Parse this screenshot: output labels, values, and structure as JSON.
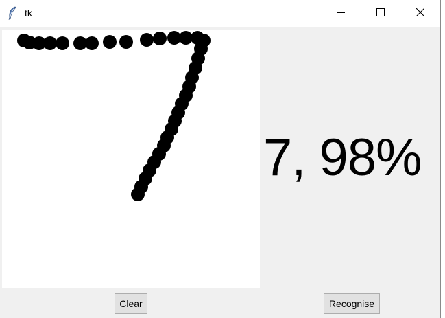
{
  "window": {
    "title": "tk",
    "icon": "feather-icon",
    "controls": [
      "minimize-icon",
      "maximize-icon",
      "close-icon"
    ]
  },
  "canvas": {
    "background": "#ffffff",
    "stroke_color": "#000000",
    "drawn_digit": "7"
  },
  "result": {
    "text": "7, 98%"
  },
  "buttons": {
    "clear_label": "Clear",
    "recognise_label": "Recognise"
  },
  "colors": {
    "window_bg": "#f0f0f0",
    "titlebar_bg": "#ffffff",
    "button_bg": "#e1e1e1",
    "button_border": "#adadad"
  }
}
